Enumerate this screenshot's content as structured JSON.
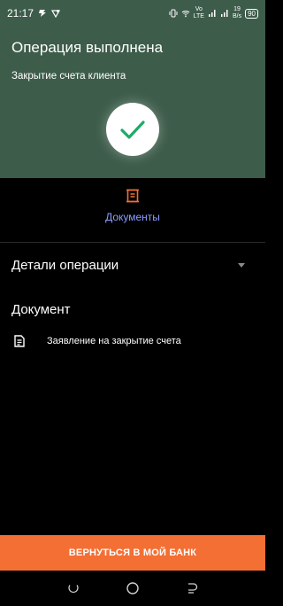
{
  "status_bar": {
    "time": "21:17",
    "network_type": "LTE",
    "network_label": "Vo",
    "speed_value": "19",
    "speed_unit": "B/s",
    "battery": "90"
  },
  "header": {
    "title": "Операция выполнена",
    "subtitle": "Закрытие счета клиента",
    "background_color": "#3d5c4a",
    "check_color": "#1faa6a"
  },
  "tabs": {
    "documents_label": "Документы",
    "documents_color": "#8c9eff",
    "icon_color": "#f36f34"
  },
  "details": {
    "label": "Детали операции"
  },
  "document_section": {
    "heading": "Документ",
    "items": [
      {
        "name": "Заявление на закрытие счета",
        "icon": "document-icon"
      }
    ]
  },
  "footer": {
    "return_button_label": "ВЕРНУТЬСЯ В МОЙ БАНК",
    "button_color": "#f36f34"
  },
  "nav": {
    "icons": [
      "recent-apps-icon",
      "home-icon",
      "back-icon"
    ]
  }
}
